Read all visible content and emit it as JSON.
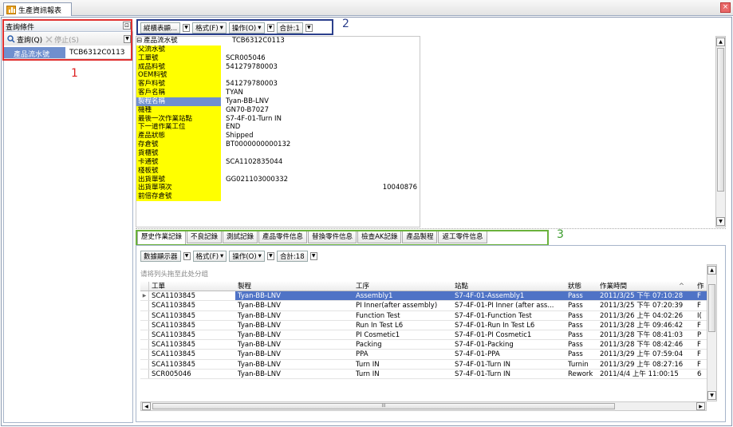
{
  "window": {
    "tab_title": "生產資訊報表",
    "close_symbol": "×"
  },
  "query_panel": {
    "header": "查詢條件",
    "pin_symbol": "⊡",
    "query_button": "查詢(Q)",
    "stop_button": "停止(S)",
    "field_label": "產品流水號",
    "field_value": "TCB6312C0113"
  },
  "annotations": {
    "box1": "1",
    "box2": "2",
    "box3": "3"
  },
  "top_toolbar": {
    "display_button": "縱橫表顯...",
    "format_menu": "格式(F)",
    "operation_menu": "操作(O)",
    "count": "合計:1"
  },
  "detail_grid": [
    {
      "label": "產品流水號",
      "value": "TCB6312C0113"
    },
    {
      "label": "父流水號",
      "value": ""
    },
    {
      "label": "工單號",
      "value": "SCR005046"
    },
    {
      "label": "成品料號",
      "value": "541279780003"
    },
    {
      "label": "OEM料號",
      "value": ""
    },
    {
      "label": "客戶料號",
      "value": "541279780003"
    },
    {
      "label": "客戶名稱",
      "value": "TYAN"
    },
    {
      "label": "製程名稱",
      "value": "Tyan-BB-LNV"
    },
    {
      "label": "機種",
      "value": "GN70-B7027"
    },
    {
      "label": "最後一次作業站點",
      "value": "S7-4F-01-Turn IN"
    },
    {
      "label": "下一道作業工位",
      "value": "END"
    },
    {
      "label": "產品狀態",
      "value": "Shipped"
    },
    {
      "label": "存倉號",
      "value": "BT0000000000132"
    },
    {
      "label": "貨櫃號",
      "value": ""
    },
    {
      "label": "卡通號",
      "value": "SCA1102835044"
    },
    {
      "label": "棧板號",
      "value": ""
    },
    {
      "label": "出貨單號",
      "value": "GG021103000332"
    },
    {
      "label": "出貨單項次",
      "value": "10040876"
    },
    {
      "label": "前倍存倉號",
      "value": ""
    }
  ],
  "tabs": [
    "歷史作業記錄",
    "不良記錄",
    "測試記錄",
    "產品零件信息",
    "替換零件信息",
    "檢查AK記錄",
    "產品製程",
    "返工零件信息"
  ],
  "lower_toolbar": {
    "display_button": "數據顯示器",
    "format_menu": "格式(F)",
    "operation_menu": "操作(O)",
    "count": "合計:18"
  },
  "group_hint": "请将列头拖至此处分组",
  "table": {
    "columns": [
      "工單",
      "製程",
      "工序",
      "站點",
      "狀態",
      "作業時間",
      "作"
    ],
    "sort_indicator": "^",
    "rows": [
      [
        "SCA1103845",
        "Tyan-BB-LNV",
        "Assembly1",
        "S7-4F-01-Assembly1",
        "Pass",
        "2011/3/25 下午 07:10:28",
        "F"
      ],
      [
        "SCA1103845",
        "Tyan-BB-LNV",
        "PI Inner(after assembly)",
        "S7-4F-01-PI Inner (after ass...",
        "Pass",
        "2011/3/25 下午 07:20:39",
        "F"
      ],
      [
        "SCA1103845",
        "Tyan-BB-LNV",
        "Function Test",
        "S7-4F-01-Function Test",
        "Pass",
        "2011/3/26 上午 04:02:26",
        "I("
      ],
      [
        "SCA1103845",
        "Tyan-BB-LNV",
        "Run In Test L6",
        "S7-4F-01-Run In Test L6",
        "Pass",
        "2011/3/28 上午 09:46:42",
        "F"
      ],
      [
        "SCA1103845",
        "Tyan-BB-LNV",
        "PI Cosmetic1",
        "S7-4F-01-PI Cosmetic1",
        "Pass",
        "2011/3/28 下午 08:41:03",
        "P"
      ],
      [
        "SCA1103845",
        "Tyan-BB-LNV",
        "Packing",
        "S7-4F-01-Packing",
        "Pass",
        "2011/3/28 下午 08:42:46",
        "F"
      ],
      [
        "SCA1103845",
        "Tyan-BB-LNV",
        "PPA",
        "S7-4F-01-PPA",
        "Pass",
        "2011/3/29 上午 07:59:04",
        "F"
      ],
      [
        "SCA1103845",
        "Tyan-BB-LNV",
        "Turn IN",
        "S7-4F-01-Turn IN",
        "Turnin",
        "2011/3/29 上午 08:27:16",
        "F"
      ],
      [
        "SCR005046",
        "Tyan-BB-LNV",
        "Turn IN",
        "S7-4F-01-Turn IN",
        "Rework",
        "2011/4/4 上午 11:00:15",
        "6"
      ]
    ]
  },
  "scroll": {
    "hscroll_grip": "III"
  }
}
